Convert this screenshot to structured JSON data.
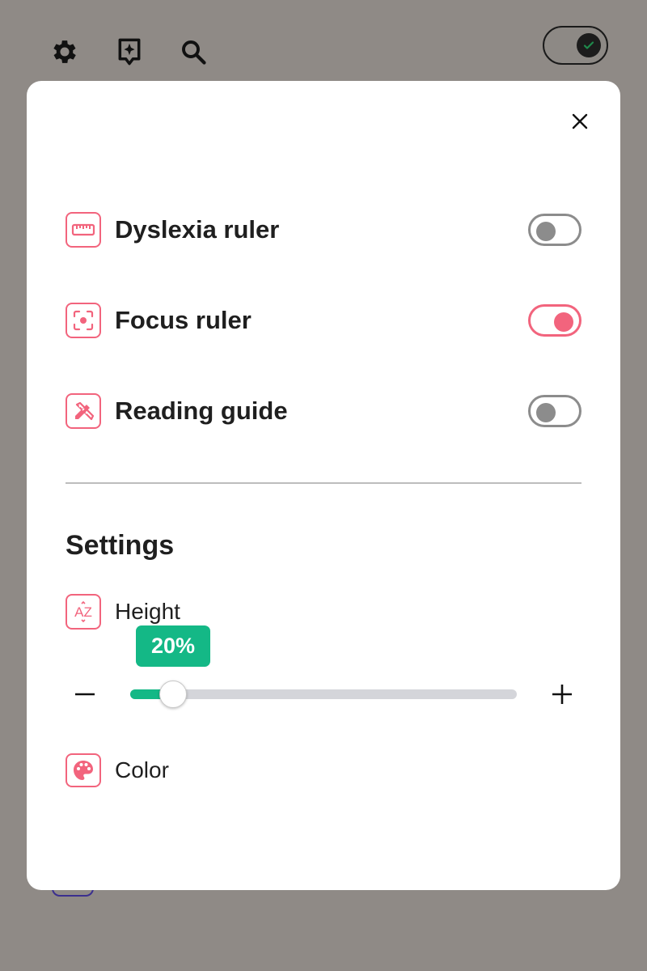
{
  "toolbar": {
    "icons": [
      "gear-icon",
      "sparkle-bookmark-icon",
      "search-icon"
    ],
    "toggle_state": "on"
  },
  "modal": {
    "close_icon": "close-icon",
    "features": [
      {
        "label": "Dyslexia ruler",
        "icon": "ruler-icon",
        "enabled": false
      },
      {
        "label": "Focus ruler",
        "icon": "focus-target-icon",
        "enabled": true
      },
      {
        "label": "Reading guide",
        "icon": "pencil-ruler-icon",
        "enabled": false
      }
    ],
    "settings": {
      "title": "Settings",
      "height": {
        "label": "Height",
        "icon": "text-height-icon",
        "value_text": "20%",
        "value_fraction": 0.11
      },
      "color": {
        "label": "Color",
        "icon": "palette-icon"
      }
    }
  },
  "colors": {
    "accent_pink": "#f2647d",
    "accent_green": "#14b886",
    "backdrop": "#8f8a86"
  }
}
